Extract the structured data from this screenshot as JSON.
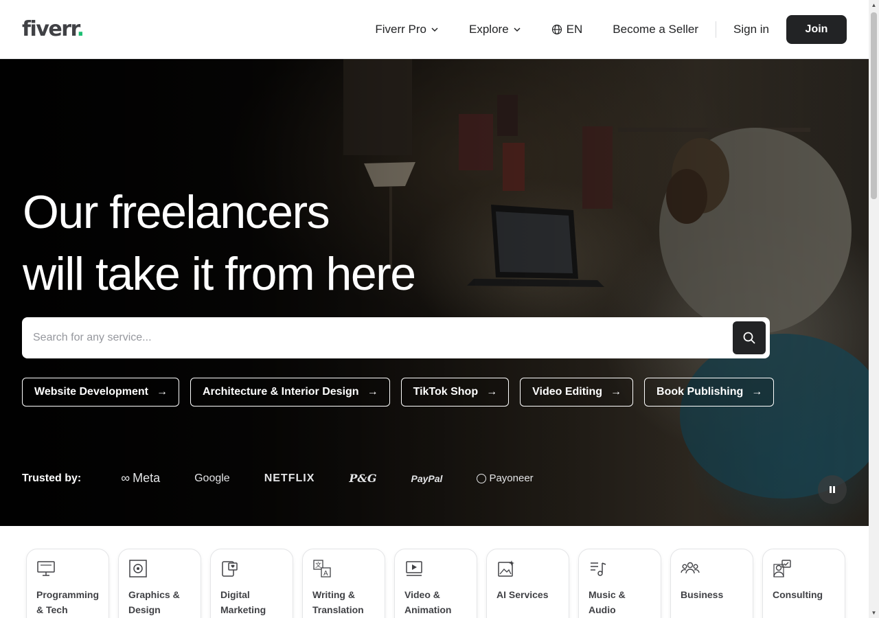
{
  "header": {
    "logo": "fiverr",
    "logo_dot": ".",
    "nav": [
      {
        "label": "Fiverr Pro",
        "dropdown": true
      },
      {
        "label": "Explore",
        "dropdown": true
      },
      {
        "label": "EN",
        "icon": "globe-icon"
      },
      {
        "label": "Become a Seller"
      }
    ],
    "sign_in": "Sign in",
    "join": "Join"
  },
  "hero": {
    "title_line1": "Our freelancers",
    "title_line2": "will take it from here",
    "search_placeholder": "Search for any service...",
    "chips": [
      "Website Development",
      "Architecture & Interior Design",
      "TikTok Shop",
      "Video Editing",
      "Book Publishing"
    ],
    "trusted_label": "Trusted by:",
    "brands": [
      "Meta",
      "Google",
      "NETFLIX",
      "P&G",
      "PayPal",
      "Payoneer"
    ]
  },
  "categories": [
    {
      "label": "Programming & Tech",
      "icon": "monitor-icon"
    },
    {
      "label": "Graphics & Design",
      "icon": "design-icon"
    },
    {
      "label": "Digital Marketing",
      "icon": "phone-heart-icon"
    },
    {
      "label": "Writing & Translation",
      "icon": "translate-icon"
    },
    {
      "label": "Video & Animation",
      "icon": "video-play-icon"
    },
    {
      "label": "AI Services",
      "icon": "ai-image-icon"
    },
    {
      "label": "Music & Audio",
      "icon": "music-icon"
    },
    {
      "label": "Business",
      "icon": "people-icon"
    },
    {
      "label": "Consulting",
      "icon": "consulting-icon"
    }
  ],
  "colors": {
    "brand_dark": "#222325",
    "logo_dot": "#1dbf73",
    "text": "#404145"
  }
}
